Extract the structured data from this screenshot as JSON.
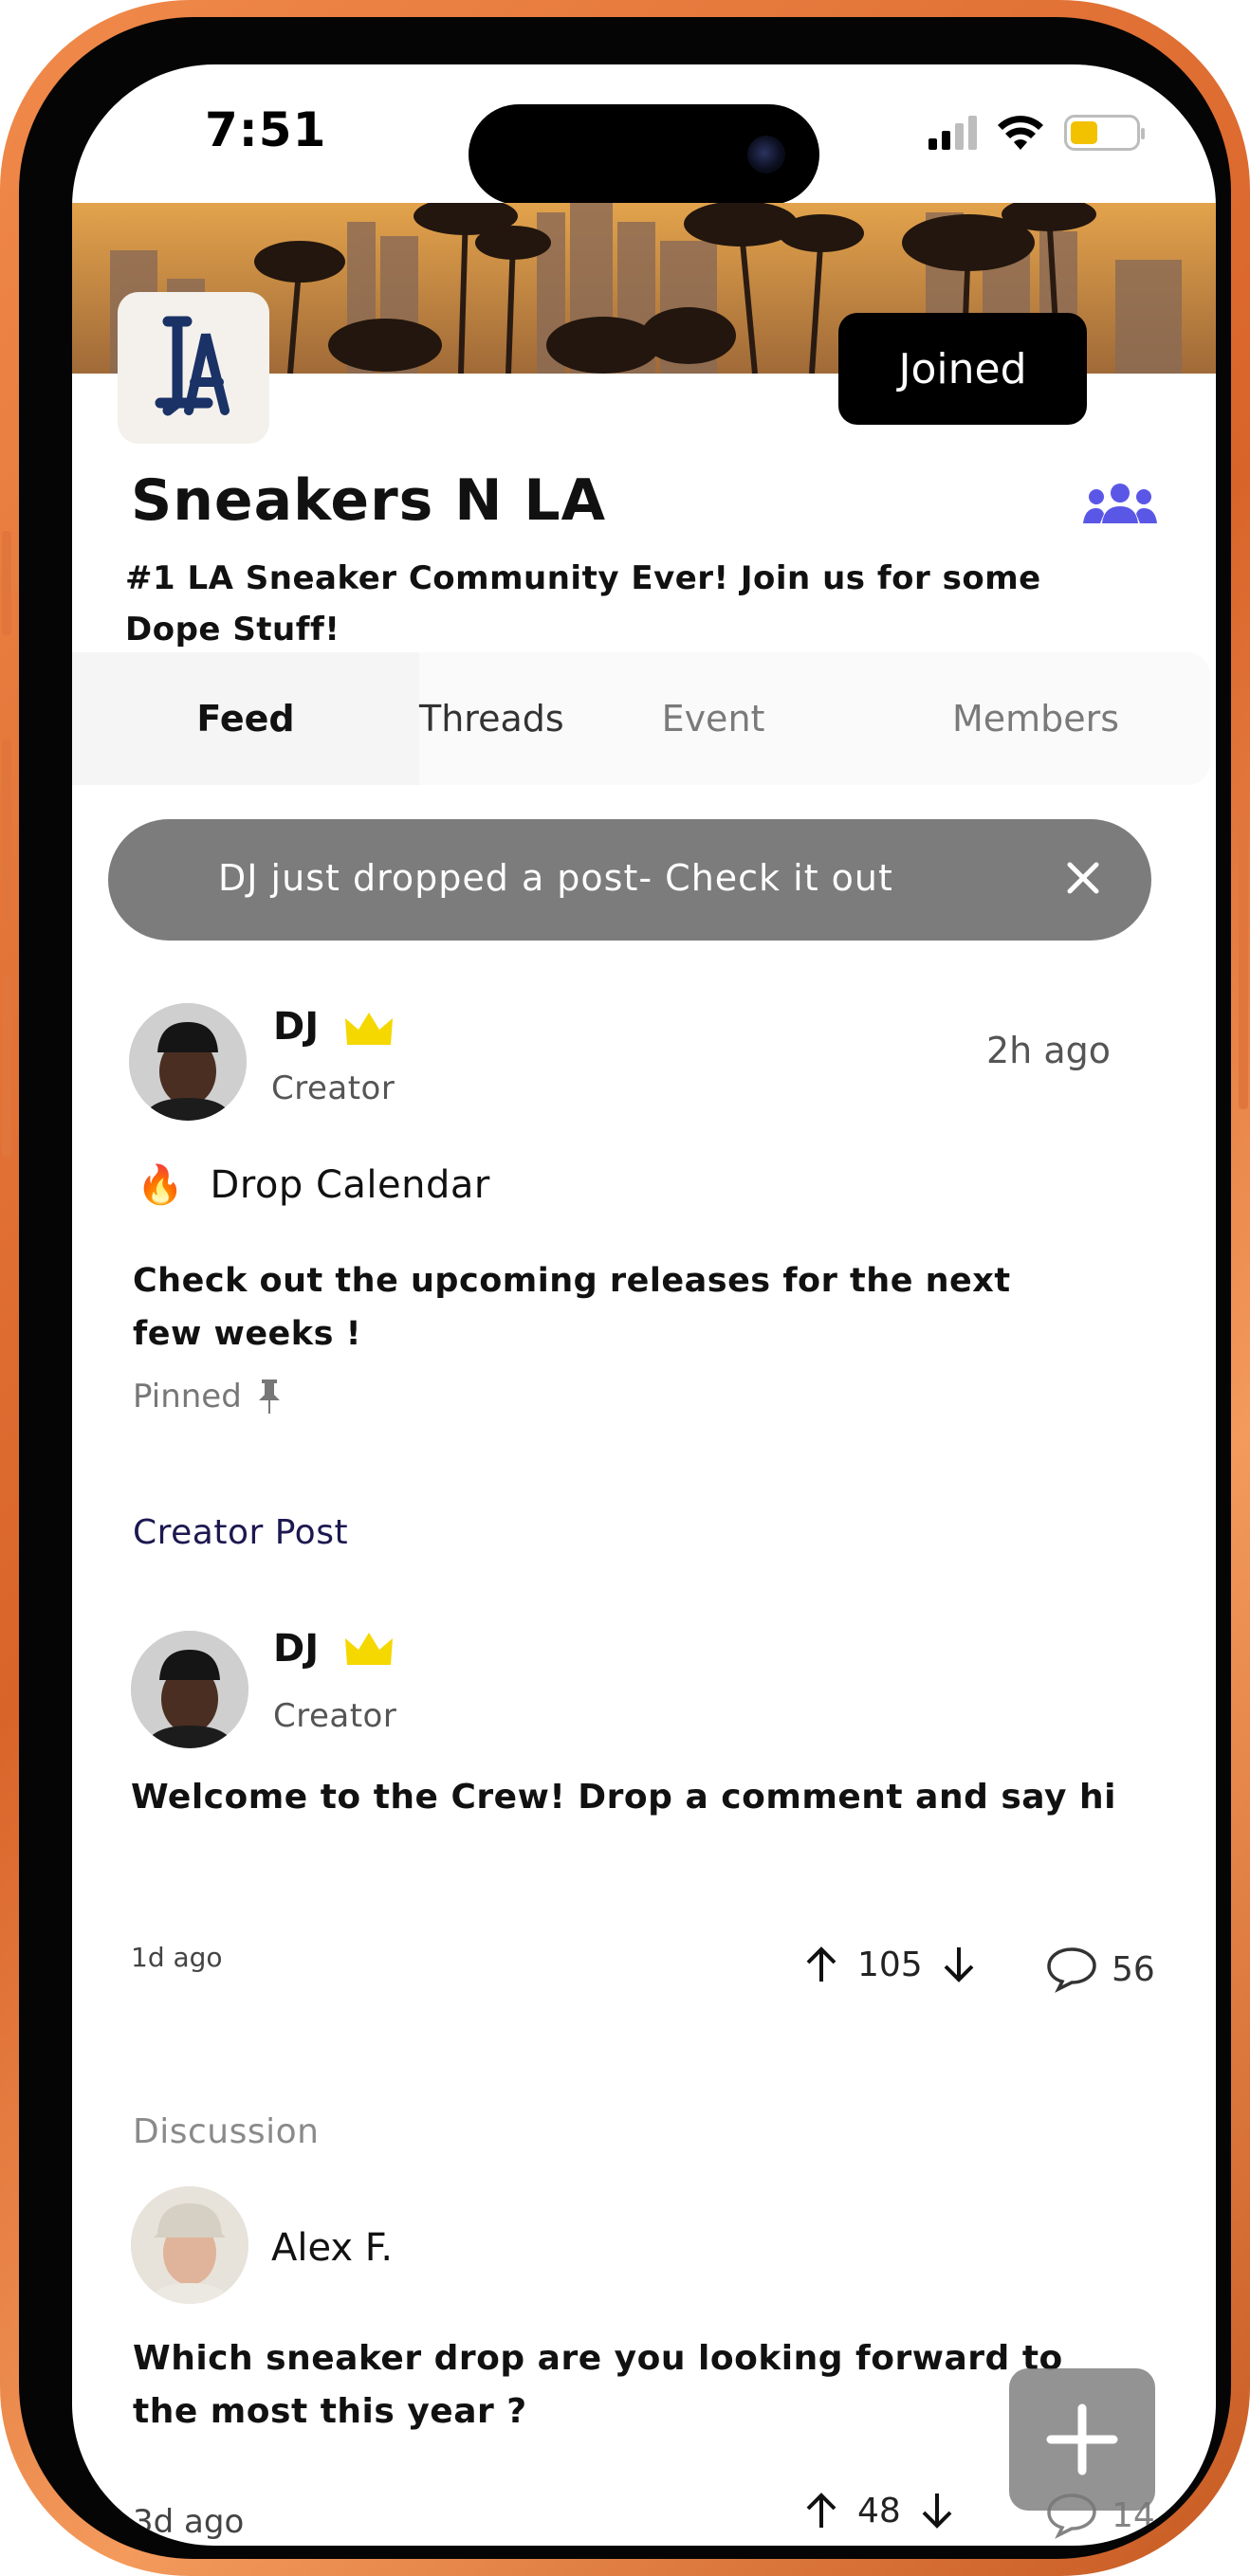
{
  "status_bar": {
    "time": "7:51"
  },
  "group": {
    "name": "Sneakers N LA",
    "description": "#1 LA Sneaker Community Ever! Join us for some Dope Stuff!",
    "join_button": "Joined",
    "logo_text": "LA"
  },
  "tabs": [
    {
      "label": "Feed",
      "active": true
    },
    {
      "label": "Threads",
      "active": false
    },
    {
      "label": "Event",
      "active": false
    },
    {
      "label": "Members",
      "active": false
    }
  ],
  "toast": {
    "text": "DJ just dropped a post- Check it out"
  },
  "pinned_post": {
    "author": "DJ",
    "role": "Creator",
    "time": "2h ago",
    "emoji": "🔥",
    "title": "Drop Calendar",
    "body": "Check out the upcoming releases for the next few weeks !",
    "pinned_label": "Pinned"
  },
  "creator_post": {
    "section": "Creator Post",
    "author": "DJ",
    "role": "Creator",
    "body": "Welcome to the Crew! Drop a comment and say hi",
    "time": "1d ago",
    "votes": "105",
    "comments": "56"
  },
  "discussion_post": {
    "section": "Discussion",
    "author": "Alex F.",
    "body": "Which sneaker drop are you looking forward to the most this year ?",
    "time": "3d ago",
    "votes": "48",
    "comments": "14"
  },
  "colors": {
    "frame": "#e0763c",
    "accent_purple": "#5b57e6",
    "crown": "#f4d800",
    "section_creator": "#1c1850",
    "toast_bg": "#7c7c7c"
  }
}
